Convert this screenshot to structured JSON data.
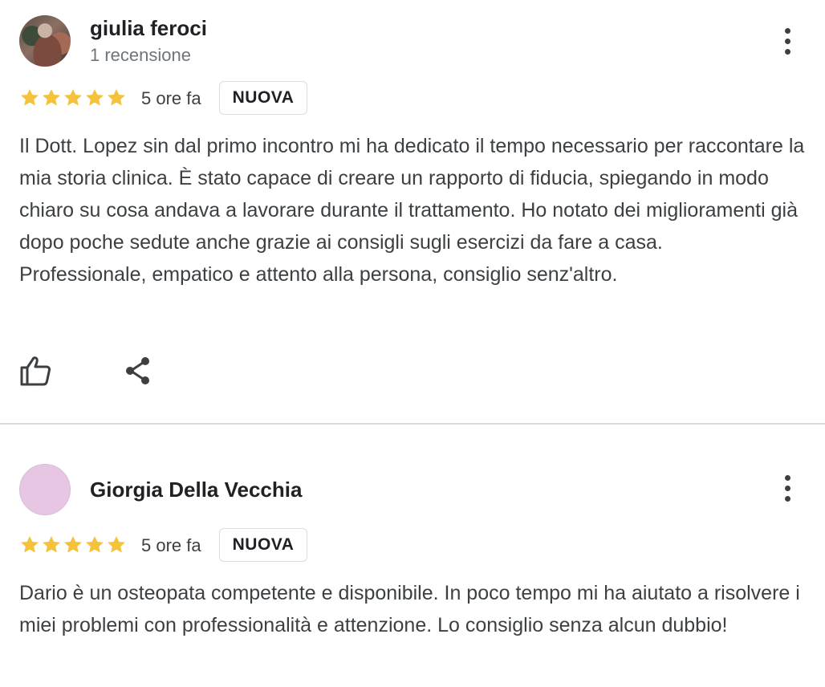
{
  "reviews": [
    {
      "author": "giulia feroci",
      "review_count": "1 recensione",
      "rating": 5,
      "time": "5 ore fa",
      "badge": "NUOVA",
      "text": "Il Dott. Lopez sin dal primo incontro mi ha dedicato il tempo necessario per raccontare la mia storia clinica. È stato capace di creare un rapporto di fiducia, spiegando in modo chiaro su cosa andava a lavorare durante il trattamento. Ho notato dei miglioramenti già dopo poche sedute anche grazie ai consigli sugli esercizi da fare a casa.\nProfessionale, empatico e attento alla persona, consiglio senz'altro."
    },
    {
      "author": "Giorgia Della Vecchia",
      "rating": 5,
      "time": "5 ore fa",
      "badge": "NUOVA",
      "text": "Dario è un osteopata competente e disponibile. In poco tempo mi ha aiutato a risolvere i miei problemi con professionalità e attenzione. Lo consiglio senza alcun dubbio!"
    }
  ],
  "colors": {
    "star": "#f4c23b",
    "divider": "#dadce0",
    "avatar_placeholder": "#e7c6e3",
    "text_secondary": "#70757a"
  },
  "icons": {
    "menu": "more-vert-icon",
    "like": "thumb-up-icon",
    "share": "share-icon",
    "rating": "star-icon"
  }
}
